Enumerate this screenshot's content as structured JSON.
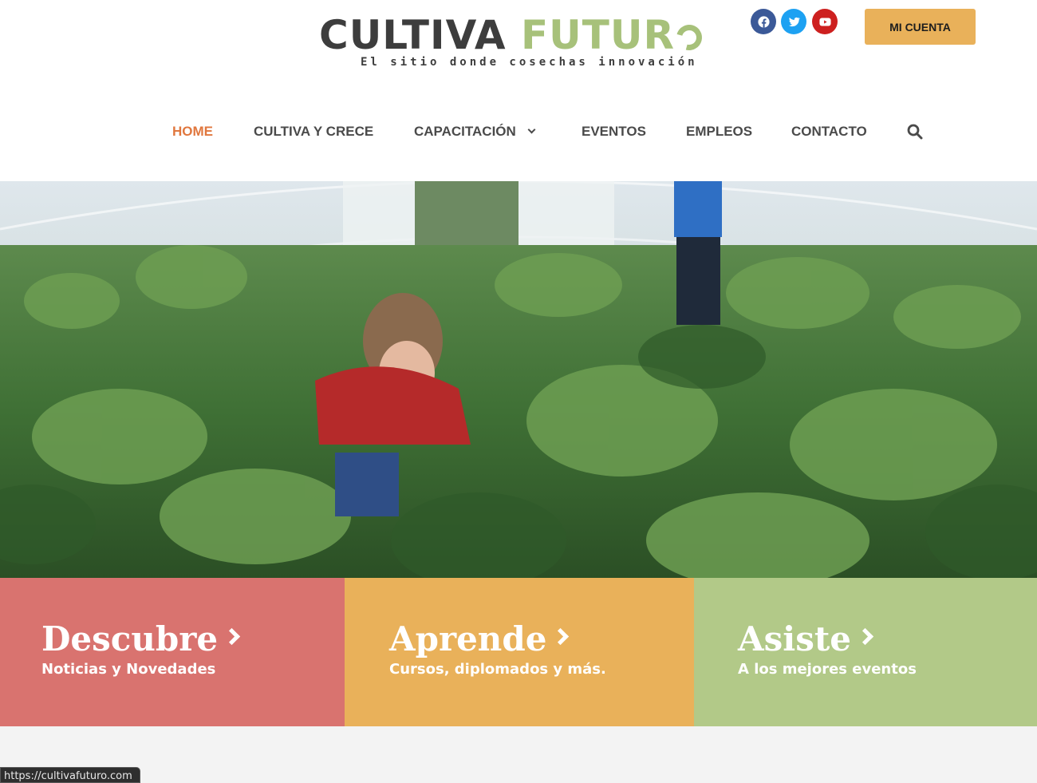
{
  "header": {
    "logo_word1": "CULTIVA",
    "logo_word2": "FUTUR",
    "tagline": "El sitio donde cosechas innovación",
    "account_button": "MI CUENTA",
    "social_icons": [
      "facebook-icon",
      "twitter-icon",
      "youtube-icon"
    ]
  },
  "nav": {
    "items": [
      {
        "label": "HOME",
        "active": true
      },
      {
        "label": "CULTIVA Y CRECE"
      },
      {
        "label": "CAPACITACIÓN",
        "has_dropdown": true
      },
      {
        "label": "EVENTOS"
      },
      {
        "label": "EMPLEOS"
      },
      {
        "label": "CONTACTO"
      }
    ],
    "search_icon": "search-icon"
  },
  "cards": [
    {
      "title": "Descubre",
      "subtitle": "Noticias y Novedades",
      "color": "#d9736f"
    },
    {
      "title": "Aprende",
      "subtitle": "Cursos, diplomados y más.",
      "color": "#e9b15a"
    },
    {
      "title": "Asiste",
      "subtitle": "A los mejores eventos",
      "color": "#b2c988"
    }
  ],
  "status_bar": {
    "url": "https://cultivafuturo.com"
  },
  "colors": {
    "accent": "#e0773e",
    "brand_green": "#a7c17a",
    "button": "#e9b15a"
  }
}
